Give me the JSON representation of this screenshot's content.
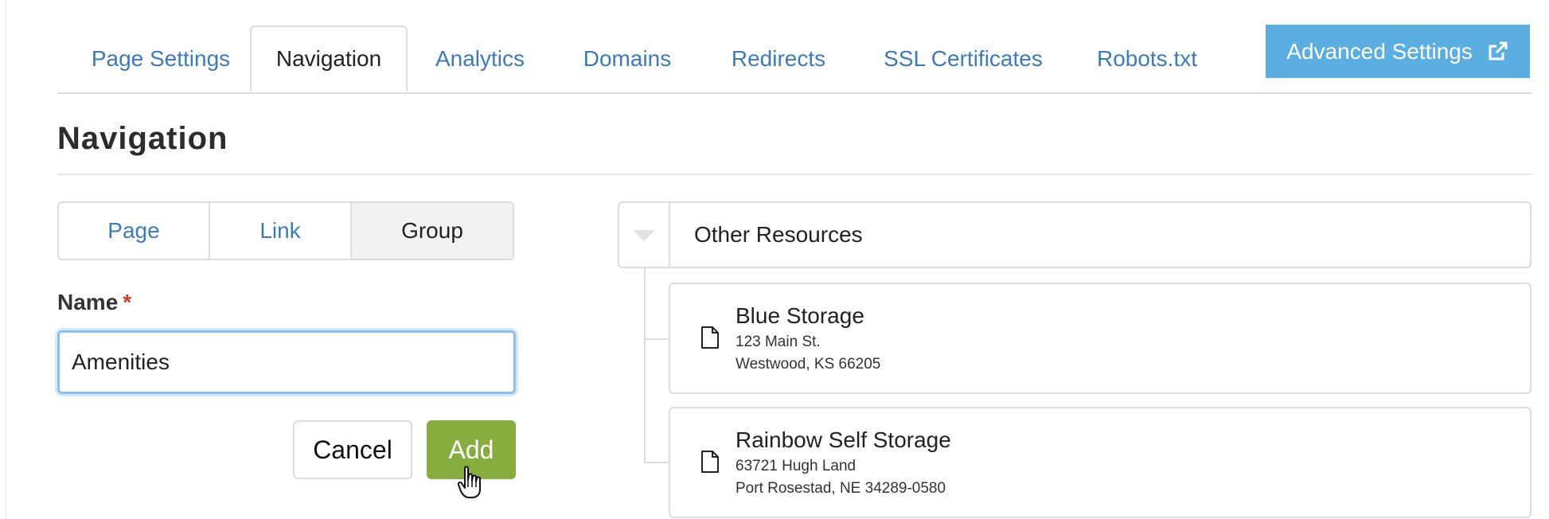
{
  "tabs": [
    {
      "label": "Page Settings",
      "active": false
    },
    {
      "label": "Navigation",
      "active": true
    },
    {
      "label": "Analytics",
      "active": false
    },
    {
      "label": "Domains",
      "active": false
    },
    {
      "label": "Redirects",
      "active": false
    },
    {
      "label": "SSL Certificates",
      "active": false
    },
    {
      "label": "Robots.txt",
      "active": false
    }
  ],
  "advanced_settings": {
    "label": "Advanced Settings",
    "icon": "external-link-icon"
  },
  "page_title": "Navigation",
  "item_types": [
    {
      "label": "Page",
      "selected": false
    },
    {
      "label": "Link",
      "selected": false
    },
    {
      "label": "Group",
      "selected": true
    }
  ],
  "form": {
    "name_label": "Name",
    "required_mark": "*",
    "name_value": "Amenities",
    "cancel_label": "Cancel",
    "add_label": "Add"
  },
  "tree": {
    "group_label": "Other Resources",
    "toggle_icon": "caret-down-icon",
    "items": [
      {
        "icon": "document-icon",
        "title": "Blue Storage",
        "line1": "123 Main St.",
        "line2": "Westwood, KS 66205"
      },
      {
        "icon": "document-icon",
        "title": "Rainbow Self Storage",
        "line1": "63721 Hugh Land",
        "line2": "Port Rosestad, NE 34289-0580"
      }
    ]
  },
  "colors": {
    "link": "#3a7bbf",
    "primary_button": "#5aaee0",
    "add_button": "#86ad3d",
    "required": "#d9372e",
    "focus_ring": "#8cc0f0"
  }
}
